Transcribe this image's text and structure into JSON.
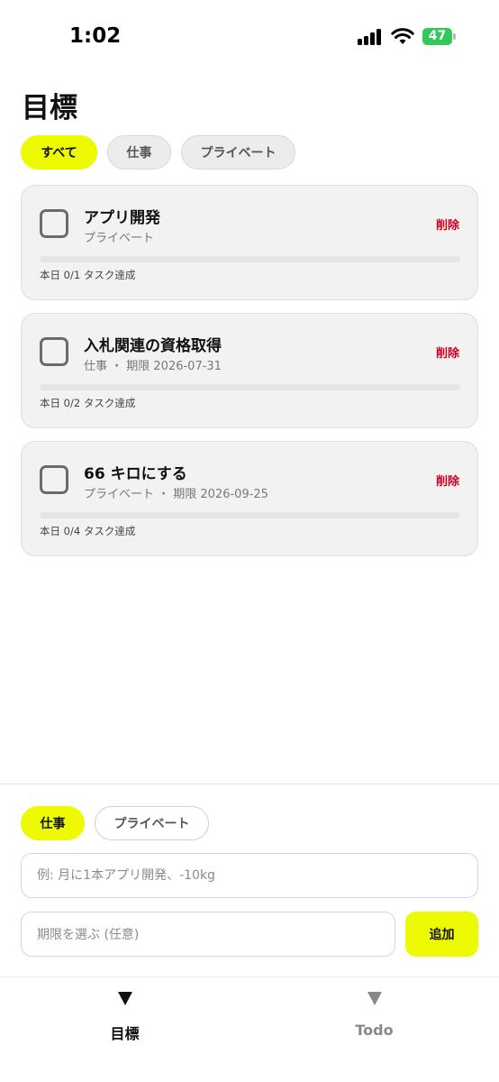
{
  "status_bar": {
    "time": "1:02",
    "battery": "47"
  },
  "page_title": "目標",
  "filters": [
    {
      "label": "すべて",
      "active": true
    },
    {
      "label": "仕事",
      "active": false
    },
    {
      "label": "プライベート",
      "active": false
    }
  ],
  "goals": [
    {
      "title": "アプリ開発",
      "meta": "プライベート",
      "delete_label": "削除",
      "progress": 0,
      "stats": "本日 0/1 タスク達成"
    },
    {
      "title": "入札関連の資格取得",
      "meta": "仕事 ・ 期限 2026-07-31",
      "delete_label": "削除",
      "progress": 0,
      "stats": "本日 0/2 タスク達成"
    },
    {
      "title": "66 キロにする",
      "meta": "プライベート ・ 期限 2026-09-25",
      "delete_label": "削除",
      "progress": 0,
      "stats": "本日 0/4 タスク達成"
    }
  ],
  "new_goal": {
    "categories": [
      {
        "label": "仕事",
        "active": true
      },
      {
        "label": "プライベート",
        "active": false
      }
    ],
    "input_placeholder": "例: 月に1本アプリ開発、-10kg",
    "deadline_placeholder": "期限を選ぶ (任意)",
    "add_label": "追加"
  },
  "tabs": [
    {
      "label": "目標",
      "icon": "triangle-down-icon",
      "active": true
    },
    {
      "label": "Todo",
      "icon": "triangle-down-icon",
      "active": false
    }
  ],
  "colors": {
    "accent": "#eefb00",
    "delete": "#d0021b",
    "battery": "#34c759"
  }
}
